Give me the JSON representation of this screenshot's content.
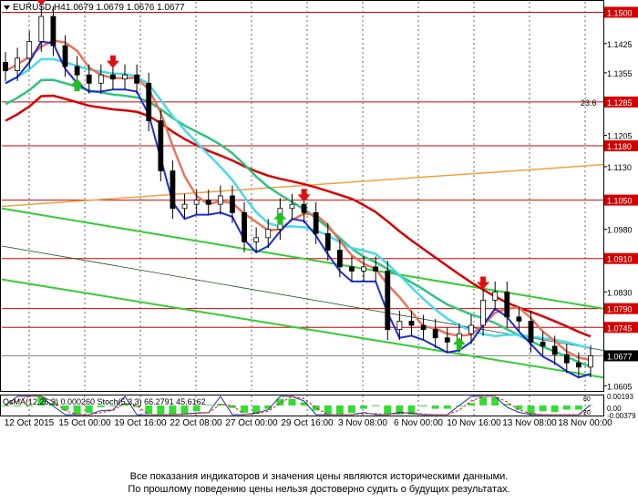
{
  "header": {
    "symbol": "EURUSD,H4",
    "ohlc": "1.0679 1.0679 1.0676 1.0677"
  },
  "indicator_label": "OsMA(12,26,9) 0.000260  Stoch(5,3,3) 66.2791 45.6162",
  "fib_label": "23.6",
  "last_price": "1.0677",
  "colors": {
    "level_line": "#d40000",
    "ma_fast": "#e8735a",
    "ma_blue": "#1e2bd6",
    "ma_cyan": "#49d9e8",
    "ma_green": "#2fc47e",
    "ma_red": "#d40000",
    "trend_orange": "#f0a040",
    "channel_green": "#33cc33",
    "arrow_down": "#e01010",
    "arrow_up": "#20c020",
    "osma_bar": "#33dd33"
  },
  "chart_data": {
    "type": "candlestick",
    "title": "EURUSD,H4",
    "x_ticks": [
      "12 Oct 2015",
      "15 Oct 00:00",
      "19 Oct 16:00",
      "22 Oct 08:00",
      "27 Oct 00:00",
      "29 Oct 16:00",
      "3 Nov 08:00",
      "6 Nov 00:00",
      "10 Nov 16:00",
      "13 Nov 08:00",
      "18 Nov 00:00"
    ],
    "y_ticks": [
      1.15,
      1.1425,
      1.1355,
      1.1285,
      1.1205,
      1.118,
      1.113,
      1.105,
      1.098,
      1.091,
      1.083,
      1.079,
      1.0745,
      1.0677,
      1.0605
    ],
    "ylim": [
      1.0595,
      1.1525
    ],
    "highlighted_levels": [
      1.15,
      1.1285,
      1.118,
      1.105,
      1.091,
      1.079,
      1.0745,
      1.0677
    ],
    "indicator_y_ticks": [
      "0.00193",
      "0.00",
      "-0.00379"
    ],
    "stoch_levels": [
      "80",
      "20"
    ],
    "price_series": [
      {
        "date": "12 Oct",
        "close": 1.136
      },
      {
        "date": "13 Oct",
        "close": 1.139
      },
      {
        "date": "14 Oct",
        "close": 1.143
      },
      {
        "date": "15 Oct",
        "close": 1.149
      },
      {
        "date": "15 Oct",
        "close": 1.142
      },
      {
        "date": "16 Oct",
        "close": 1.137
      },
      {
        "date": "19 Oct",
        "close": 1.135
      },
      {
        "date": "19 Oct",
        "close": 1.133
      },
      {
        "date": "20 Oct",
        "close": 1.135
      },
      {
        "date": "21 Oct",
        "close": 1.134
      },
      {
        "date": "21 Oct",
        "close": 1.135
      },
      {
        "date": "22 Oct",
        "close": 1.133
      },
      {
        "date": "22 Oct",
        "close": 1.124
      },
      {
        "date": "22 Oct",
        "close": 1.112
      },
      {
        "date": "23 Oct",
        "close": 1.103
      },
      {
        "date": "26 Oct",
        "close": 1.104
      },
      {
        "date": "26 Oct",
        "close": 1.105
      },
      {
        "date": "27 Oct",
        "close": 1.104
      },
      {
        "date": "27 Oct",
        "close": 1.106
      },
      {
        "date": "28 Oct",
        "close": 1.102
      },
      {
        "date": "28 Oct",
        "close": 1.095
      },
      {
        "date": "29 Oct",
        "close": 1.096
      },
      {
        "date": "29 Oct",
        "close": 1.098
      },
      {
        "date": "30 Oct",
        "close": 1.103
      },
      {
        "date": "30 Oct",
        "close": 1.104
      },
      {
        "date": "2 Nov",
        "close": 1.102
      },
      {
        "date": "3 Nov",
        "close": 1.097
      },
      {
        "date": "3 Nov",
        "close": 1.093
      },
      {
        "date": "4 Nov",
        "close": 1.089
      },
      {
        "date": "4 Nov",
        "close": 1.088
      },
      {
        "date": "5 Nov",
        "close": 1.089
      },
      {
        "date": "5 Nov",
        "close": 1.088
      },
      {
        "date": "6 Nov",
        "close": 1.074
      },
      {
        "date": "6 Nov",
        "close": 1.076
      },
      {
        "date": "9 Nov",
        "close": 1.075
      },
      {
        "date": "9 Nov",
        "close": 1.074
      },
      {
        "date": "10 Nov",
        "close": 1.072
      },
      {
        "date": "10 Nov",
        "close": 1.071
      },
      {
        "date": "11 Nov",
        "close": 1.073
      },
      {
        "date": "11 Nov",
        "close": 1.075
      },
      {
        "date": "12 Nov",
        "close": 1.081
      },
      {
        "date": "12 Nov",
        "close": 1.083
      },
      {
        "date": "13 Nov",
        "close": 1.077
      },
      {
        "date": "13 Nov",
        "close": 1.076
      },
      {
        "date": "16 Nov",
        "close": 1.071
      },
      {
        "date": "16 Nov",
        "close": 1.07
      },
      {
        "date": "17 Nov",
        "close": 1.068
      },
      {
        "date": "17 Nov",
        "close": 1.066
      },
      {
        "date": "18 Nov",
        "close": 1.065
      },
      {
        "date": "18 Nov",
        "close": 1.0677
      }
    ],
    "down_signals": [
      "15 Oct",
      "21 Oct",
      "2 Nov",
      "12 Nov"
    ],
    "up_signals": [
      "19 Oct",
      "30 Oct",
      "11 Nov"
    ]
  },
  "disclaimer": {
    "line1": "Все показания индикаторов и значения цены являются историческими данными.",
    "line2": "По прошлому поведению цены нельзя достоверно судить о будущих результатах."
  }
}
